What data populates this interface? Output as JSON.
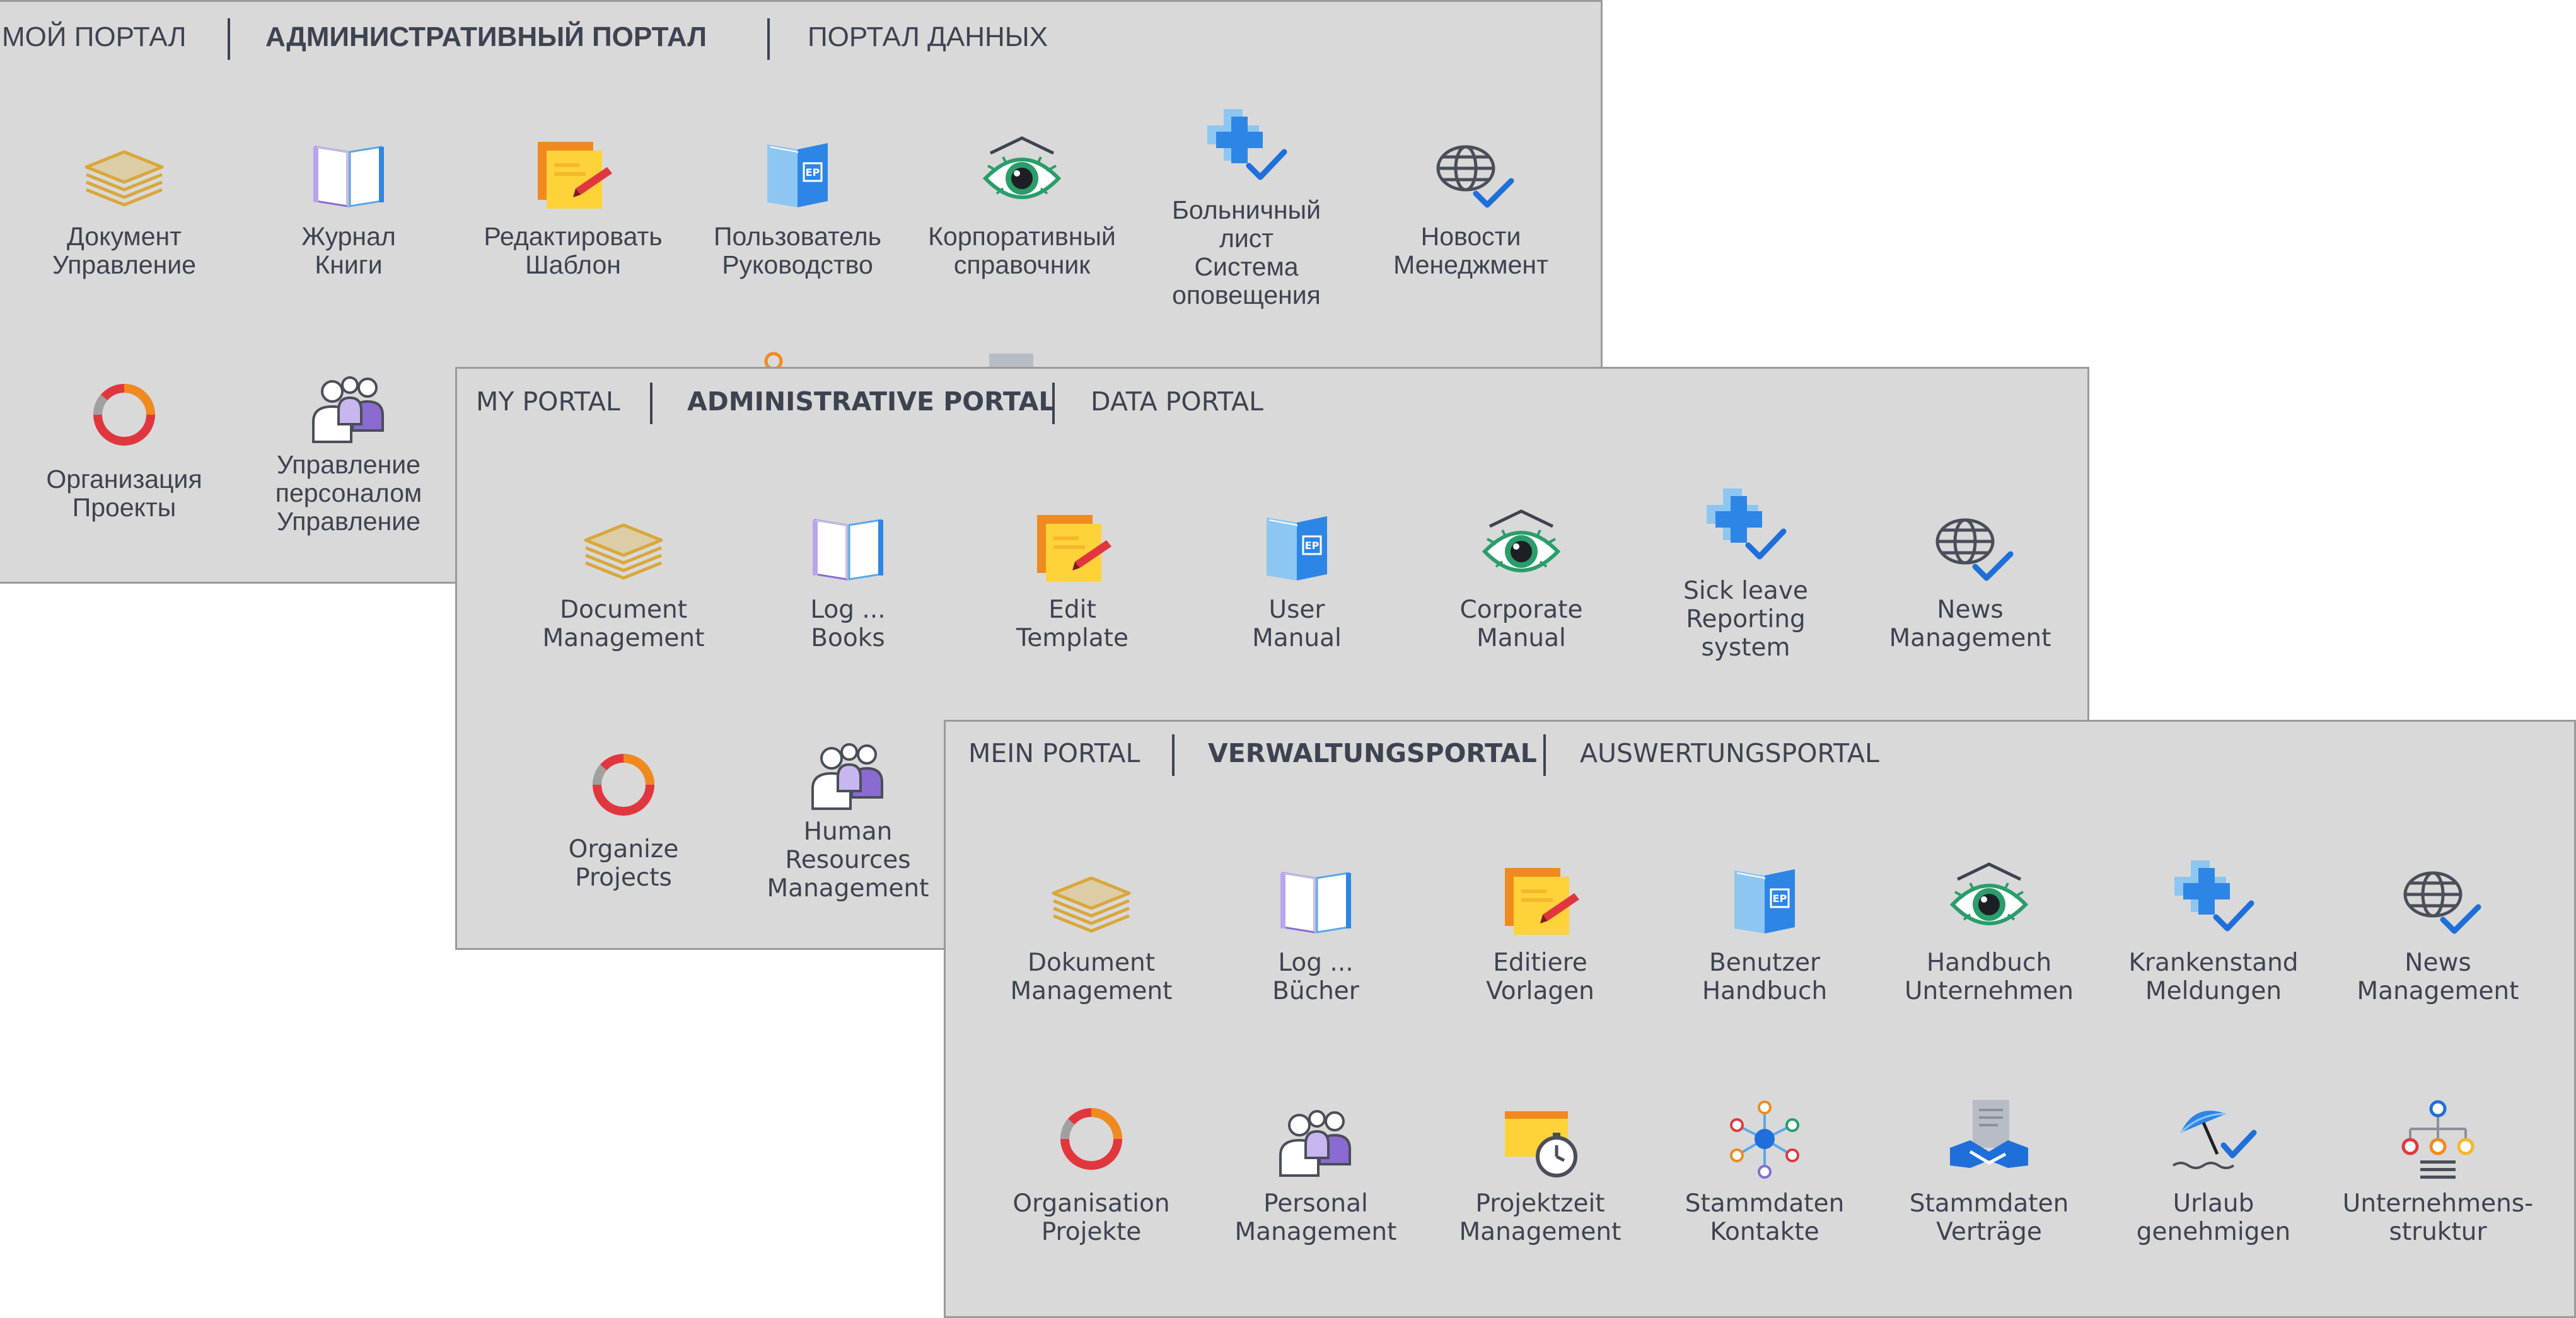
{
  "colors": {
    "panel_bg": "#d9d9d9",
    "text": "#3d4350",
    "gold": "#d9a73a",
    "blue": "#1e6fd9",
    "light_blue": "#5ba7e8",
    "orange": "#f08a1e",
    "red": "#e0373f",
    "green": "#2a9d6a",
    "purple": "#8a6bd1"
  },
  "panel_ru": {
    "tabs": [
      {
        "label": "МОЙ ПОРТАЛ"
      },
      {
        "label": "АДМИНИСТРАТИВНЫЙ ПОРТАЛ"
      },
      {
        "label": "ПОРТАЛ ДАННЫХ"
      }
    ],
    "tiles": [
      {
        "label": "Документ\nУправление",
        "icon": "document-stack-icon"
      },
      {
        "label": "Журнал\nКниги",
        "icon": "open-book-icon"
      },
      {
        "label": "Редактировать\nШаблон",
        "icon": "edit-template-icon"
      },
      {
        "label": "Пользователь\nРуководство",
        "icon": "manual-book-icon"
      },
      {
        "label": "Корпоративный\nсправочник",
        "icon": "eye-icon"
      },
      {
        "label": "Больничный\nлист\nСистема\nоповещения",
        "icon": "medical-cross-check-icon"
      },
      {
        "label": "Новости\nМенеджмент",
        "icon": "globe-check-icon"
      },
      {
        "label": "Организация\nПроекты",
        "icon": "donut-icon"
      },
      {
        "label": "Управление\nперсоналом\nУправление",
        "icon": "people-group-icon"
      }
    ]
  },
  "panel_en": {
    "tabs": [
      {
        "label": "MY PORTAL"
      },
      {
        "label": "ADMINISTRATIVE PORTAL"
      },
      {
        "label": "DATA PORTAL"
      }
    ],
    "tiles": [
      {
        "label": "Document\nManagement",
        "icon": "document-stack-icon"
      },
      {
        "label": "Log ...\nBooks",
        "icon": "open-book-icon"
      },
      {
        "label": "Edit\nTemplate",
        "icon": "edit-template-icon"
      },
      {
        "label": "User\nManual",
        "icon": "manual-book-icon"
      },
      {
        "label": "Corporate\nManual",
        "icon": "eye-icon"
      },
      {
        "label": "Sick leave\nReporting\nsystem",
        "icon": "medical-cross-check-icon"
      },
      {
        "label": "News\nManagement",
        "icon": "globe-check-icon"
      },
      {
        "label": "Organize\nProjects",
        "icon": "donut-icon"
      },
      {
        "label": "Human\nResources\nManagement",
        "icon": "people-group-icon"
      }
    ]
  },
  "panel_de": {
    "tabs": [
      {
        "label": "MEIN PORTAL"
      },
      {
        "label": "VERWALTUNGSPORTAL"
      },
      {
        "label": "AUSWERTUNGSPORTAL"
      }
    ],
    "tiles": [
      {
        "label": "Dokument\nManagement",
        "icon": "document-stack-icon"
      },
      {
        "label": "Log ...\nBücher",
        "icon": "open-book-icon"
      },
      {
        "label": "Editiere\nVorlagen",
        "icon": "edit-template-icon"
      },
      {
        "label": "Benutzer\nHandbuch",
        "icon": "manual-book-icon"
      },
      {
        "label": "Handbuch\nUnternehmen",
        "icon": "eye-icon"
      },
      {
        "label": "Krankenstand\nMeldungen",
        "icon": "medical-cross-check-icon"
      },
      {
        "label": "News\nManagement",
        "icon": "globe-check-icon"
      },
      {
        "label": "Organisation\nProjekte",
        "icon": "donut-icon"
      },
      {
        "label": "Personal\nManagement",
        "icon": "people-group-icon"
      },
      {
        "label": "Projektzeit\nManagement",
        "icon": "folder-stopwatch-icon"
      },
      {
        "label": "Stammdaten\nKontakte",
        "icon": "network-contacts-icon"
      },
      {
        "label": "Stammdaten\nVerträge",
        "icon": "handshake-contract-icon"
      },
      {
        "label": "Urlaub\ngenehmigen",
        "icon": "umbrella-check-icon"
      },
      {
        "label": "Unternehmens-\nstruktur",
        "icon": "org-chart-icon"
      }
    ]
  }
}
